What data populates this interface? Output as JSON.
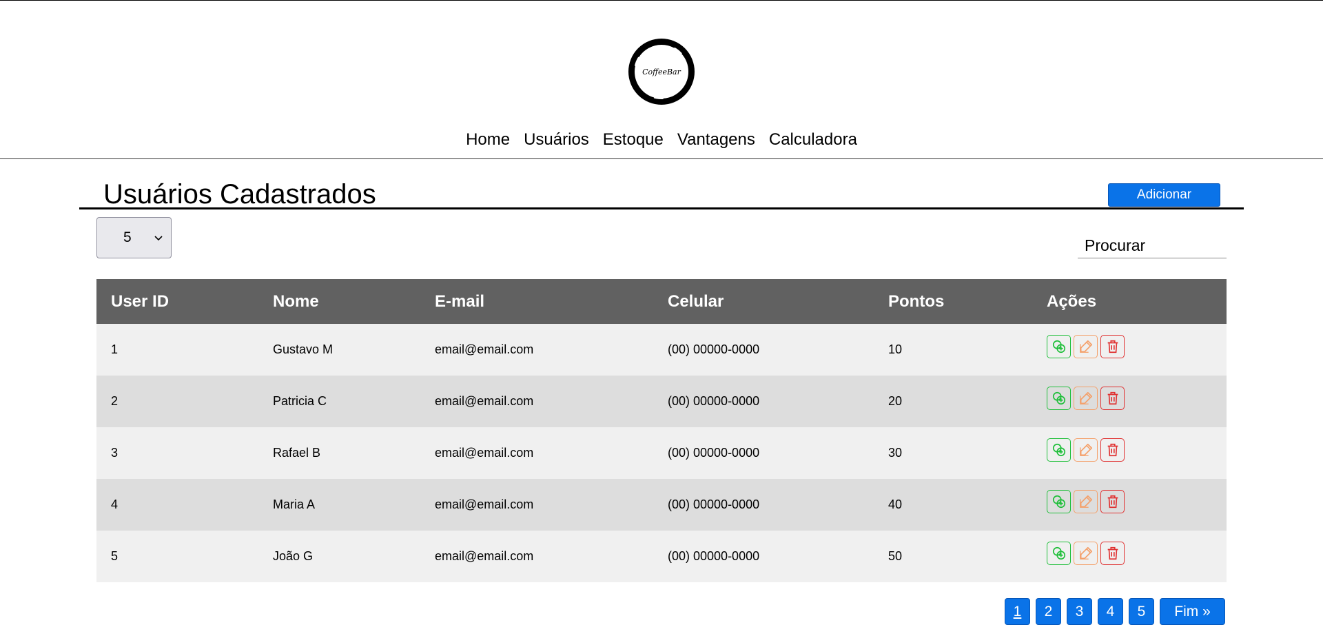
{
  "brand": {
    "logo_text": "CoffeeBar"
  },
  "nav": [
    {
      "label": "Home"
    },
    {
      "label": "Usuários"
    },
    {
      "label": "Estoque"
    },
    {
      "label": "Vantagens"
    },
    {
      "label": "Calculadora"
    }
  ],
  "page": {
    "title": "Usuários Cadastrados",
    "add_label": "Adicionar",
    "page_size": "5",
    "search_placeholder": "Procurar"
  },
  "table": {
    "headers": [
      "User ID",
      "Nome",
      "E-mail",
      "Celular",
      "Pontos",
      "Ações"
    ],
    "rows": [
      {
        "id": "1",
        "name": "Gustavo M",
        "email": "email@email.com",
        "phone": "(00) 00000-0000",
        "points": "10"
      },
      {
        "id": "2",
        "name": "Patricia C",
        "email": "email@email.com",
        "phone": "(00) 00000-0000",
        "points": "20"
      },
      {
        "id": "3",
        "name": "Rafael B",
        "email": "email@email.com",
        "phone": "(00) 00000-0000",
        "points": "30"
      },
      {
        "id": "4",
        "name": "Maria A",
        "email": "email@email.com",
        "phone": "(00) 00000-0000",
        "points": "40"
      },
      {
        "id": "5",
        "name": "João G",
        "email": "email@email.com",
        "phone": "(00) 00000-0000",
        "points": "50"
      }
    ],
    "action_icons": [
      "add-points-icon",
      "edit-icon",
      "trash-icon"
    ]
  },
  "pagination": {
    "pages": [
      "1",
      "2",
      "3",
      "4",
      "5"
    ],
    "current": "1",
    "end_label": "Fim »"
  },
  "colors": {
    "primary": "#0a73e8",
    "header_bg": "#616161",
    "row_odd": "#f0f0f0",
    "row_even": "#dddddd",
    "action_green": "#1fbf3a",
    "action_orange": "#f4a06a",
    "action_red": "#e03131"
  }
}
